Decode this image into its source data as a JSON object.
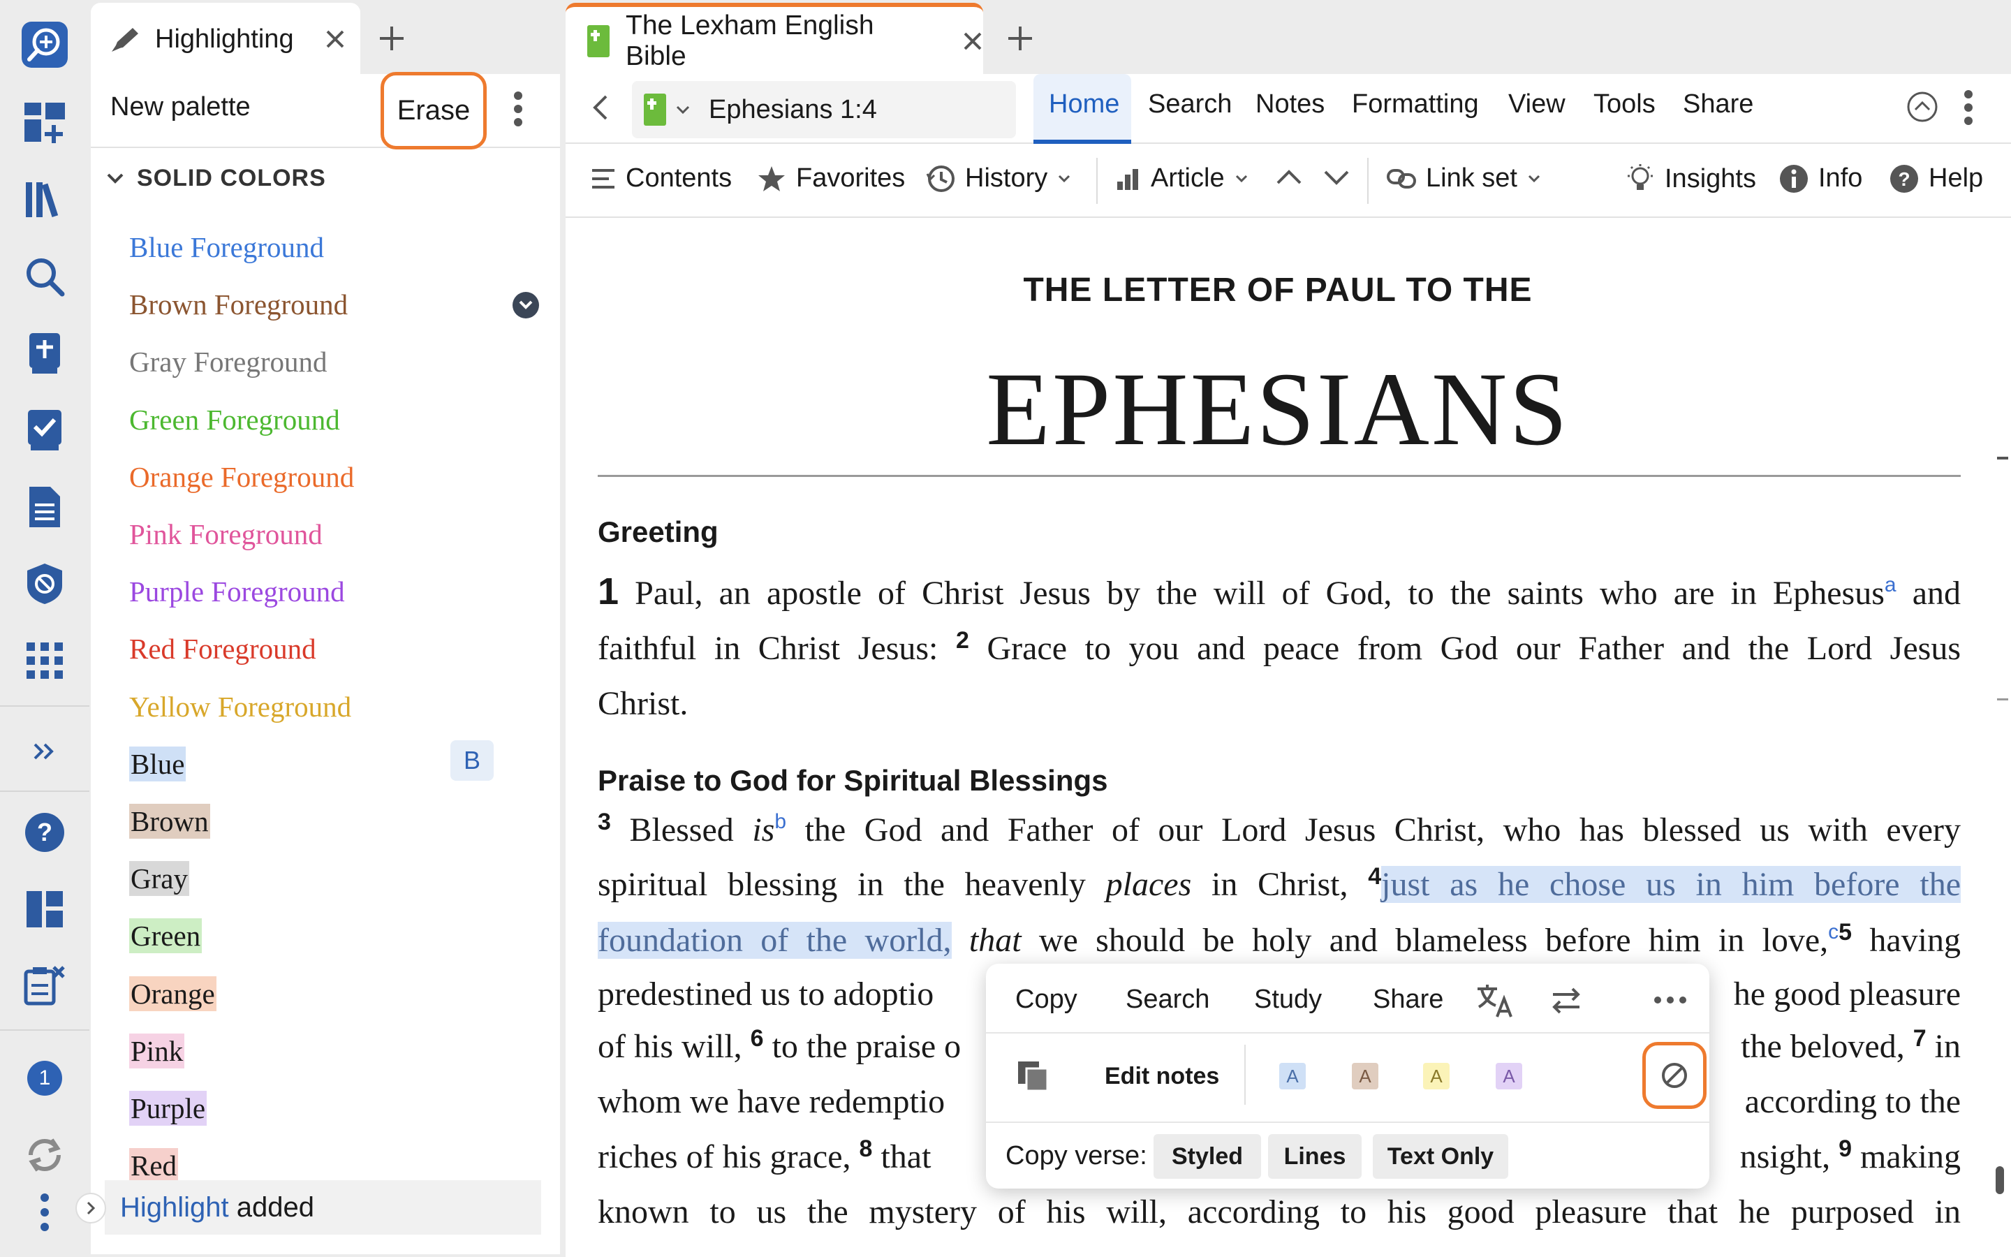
{
  "colors": {
    "accent": "#ee7a2e",
    "link": "#2e62b4",
    "highlight_blue": "#d6e4f8"
  },
  "rail": {
    "badge_count": "1",
    "icons": [
      "search-plus-icon",
      "dashboard-add-icon",
      "library-icon",
      "search-icon",
      "bible-add-icon",
      "checklist-icon",
      "document-icon",
      "shield-icon",
      "apps-grid-icon",
      "expand-icon",
      "help-icon",
      "layout-icon",
      "clipboard-x-icon",
      "badge-icon",
      "sync-icon",
      "more-icon"
    ]
  },
  "highlight_panel": {
    "tab_title": "Highlighting",
    "new_palette": "New palette",
    "erase": "Erase",
    "section": "SOLID COLORS",
    "foregrounds": [
      {
        "label": "Blue Foreground",
        "color": "#3b78d8"
      },
      {
        "label": "Brown Foreground",
        "color": "#8b5530"
      },
      {
        "label": "Gray Foreground",
        "color": "#777777"
      },
      {
        "label": "Green Foreground",
        "color": "#4cb830"
      },
      {
        "label": "Orange Foreground",
        "color": "#ea6a2a"
      },
      {
        "label": "Pink Foreground",
        "color": "#e0559b"
      },
      {
        "label": "Purple Foreground",
        "color": "#9b48e0"
      },
      {
        "label": "Red Foreground",
        "color": "#d93a2a"
      },
      {
        "label": "Yellow Foreground",
        "color": "#d8a72a"
      }
    ],
    "backgrounds": [
      {
        "label": "Blue",
        "color": "#cfe0f6"
      },
      {
        "label": "Brown",
        "color": "#e0cdbf"
      },
      {
        "label": "Gray",
        "color": "#d8d8d8"
      },
      {
        "label": "Green",
        "color": "#cdeec4"
      },
      {
        "label": "Orange",
        "color": "#f8d4c0"
      },
      {
        "label": "Pink",
        "color": "#f6d2e4"
      },
      {
        "label": "Purple",
        "color": "#e2d2f6"
      },
      {
        "label": "Red",
        "color": "#f6d0cc"
      }
    ],
    "blue_key": "B",
    "toast": {
      "link": "Highlight",
      "text": " added"
    }
  },
  "bible_panel": {
    "tab_title": "The Lexham English Bible",
    "reference": "Ephesians 1:4",
    "menu": [
      "Home",
      "Search",
      "Notes",
      "Formatting",
      "View",
      "Tools",
      "Share"
    ],
    "toolbar": {
      "contents": "Contents",
      "favorites": "Favorites",
      "history": "History",
      "article": "Article",
      "link_set": "Link set",
      "insights": "Insights",
      "info": "Info",
      "help": "Help"
    },
    "book_pre": "THE LETTER OF PAUL TO THE",
    "book_title": "EPHESIANS",
    "heading_greeting": "Greeting",
    "heading_praise": "Praise to God for Spiritual Blessings",
    "text": {
      "l1a": " Paul, an apostle of Christ Jesus by the will of God, to the saints who are in Ephesus",
      "l1b": " and",
      "l2a": "faithful in Christ Jesus: ",
      "l2b": " Grace to you and peace from God our Father and the Lord Jesus",
      "l3": "Christ.",
      "l4a": " Blessed ",
      "l4b": "is",
      "l4c": " the God and Father of our Lord Jesus Christ, who has blessed us with every",
      "l5a": "spiritual blessing in the heavenly ",
      "l5b": "places",
      "l5c": " in Christ, ",
      "l5d": "just as he chose us in him before the",
      "l6a": "foundation of the world,",
      "l6b": " ",
      "l6c": "that",
      "l6d": " we should be holy and blameless before him in love,",
      "l6e": " having",
      "l7a": "predestined us to adoptio",
      "l7b": "he good pleasure",
      "l8a": "of his will, ",
      "l8b": " to the praise o",
      "l8c": " the beloved, ",
      "l8d": " in",
      "l9a": "whom we have redemptio",
      "l9b": "according to the",
      "l10a": "riches of his grace, ",
      "l10b": " that",
      "l10c": "nsight, ",
      "l10d": " making",
      "l11": "known to us the mystery of his will, according to his good pleasure that he purposed in"
    },
    "verse_nums": {
      "v1": "1",
      "v2": "2",
      "v3": "3",
      "v4": "4",
      "v5": "5",
      "v6": "6",
      "v7": "7",
      "v8": "8",
      "v9": "9"
    },
    "footnotes": {
      "a": "a",
      "b": "b",
      "c": "c"
    }
  },
  "popup": {
    "actions": [
      "Copy",
      "Search",
      "Study",
      "Share"
    ],
    "edit_notes": "Edit notes",
    "swatches": [
      {
        "label": "A",
        "bg": "#cfe0f6",
        "fg": "#4a6fa8"
      },
      {
        "label": "A",
        "bg": "#e0cdbf",
        "fg": "#7a5a44"
      },
      {
        "label": "A",
        "bg": "#fbf3b8",
        "fg": "#8a7a2a"
      },
      {
        "label": "A",
        "bg": "#e2d2f6",
        "fg": "#7a5aa8"
      }
    ],
    "copy_verse": "Copy verse:",
    "copy_options": [
      "Styled",
      "Lines",
      "Text Only"
    ]
  }
}
